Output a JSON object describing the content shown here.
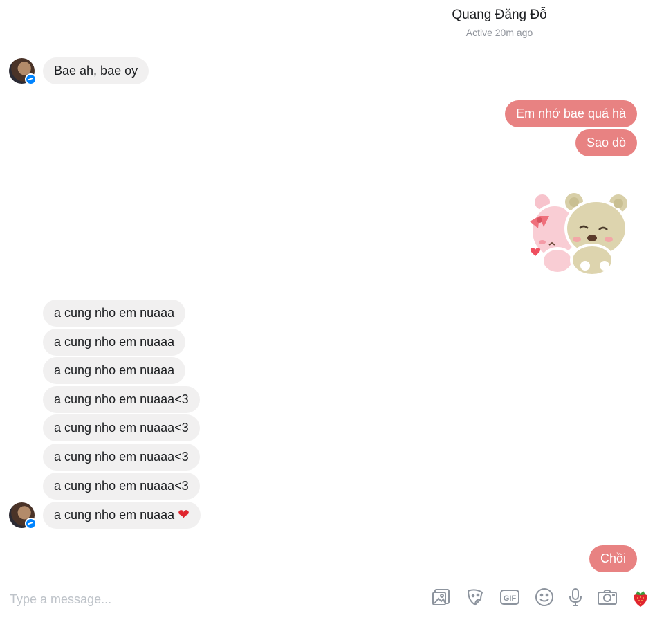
{
  "header": {
    "contact_name": "Quang Đăng Đỗ",
    "status": "Active 20m ago"
  },
  "messages": [
    {
      "from": "them",
      "text": "Bae ah, bae oy"
    },
    {
      "from": "me",
      "text": "Em nhớ bae quá hà"
    },
    {
      "from": "me",
      "text": "Sao dò"
    },
    {
      "from": "me",
      "type": "sticker",
      "sticker": "bears-hug-sticker"
    },
    {
      "from": "them",
      "text": "a cung nho em nuaaa"
    },
    {
      "from": "them",
      "text": "a cung nho em nuaaa"
    },
    {
      "from": "them",
      "text": "a cung nho em nuaaa"
    },
    {
      "from": "them",
      "text": "a cung nho em nuaaa<3"
    },
    {
      "from": "them",
      "text": "a cung nho em nuaaa<3"
    },
    {
      "from": "them",
      "text": "a cung nho em nuaaa<3"
    },
    {
      "from": "them",
      "text": "a cung nho em nuaaa<3"
    },
    {
      "from": "them",
      "text": "a cung nho em nuaaa",
      "emoji": "❤"
    },
    {
      "from": "me",
      "text": "Chồi"
    }
  ],
  "composer": {
    "placeholder": "Type a message...",
    "tools": [
      "photo-icon",
      "sticker-icon",
      "gif-icon",
      "emoji-icon",
      "microphone-icon",
      "camera-icon",
      "strawberry-icon"
    ],
    "gif_label": "GIF"
  },
  "colors": {
    "outgoing_bubble": "#e88282",
    "incoming_bubble": "#f1f0f0",
    "messenger_badge": "#0084ff"
  }
}
